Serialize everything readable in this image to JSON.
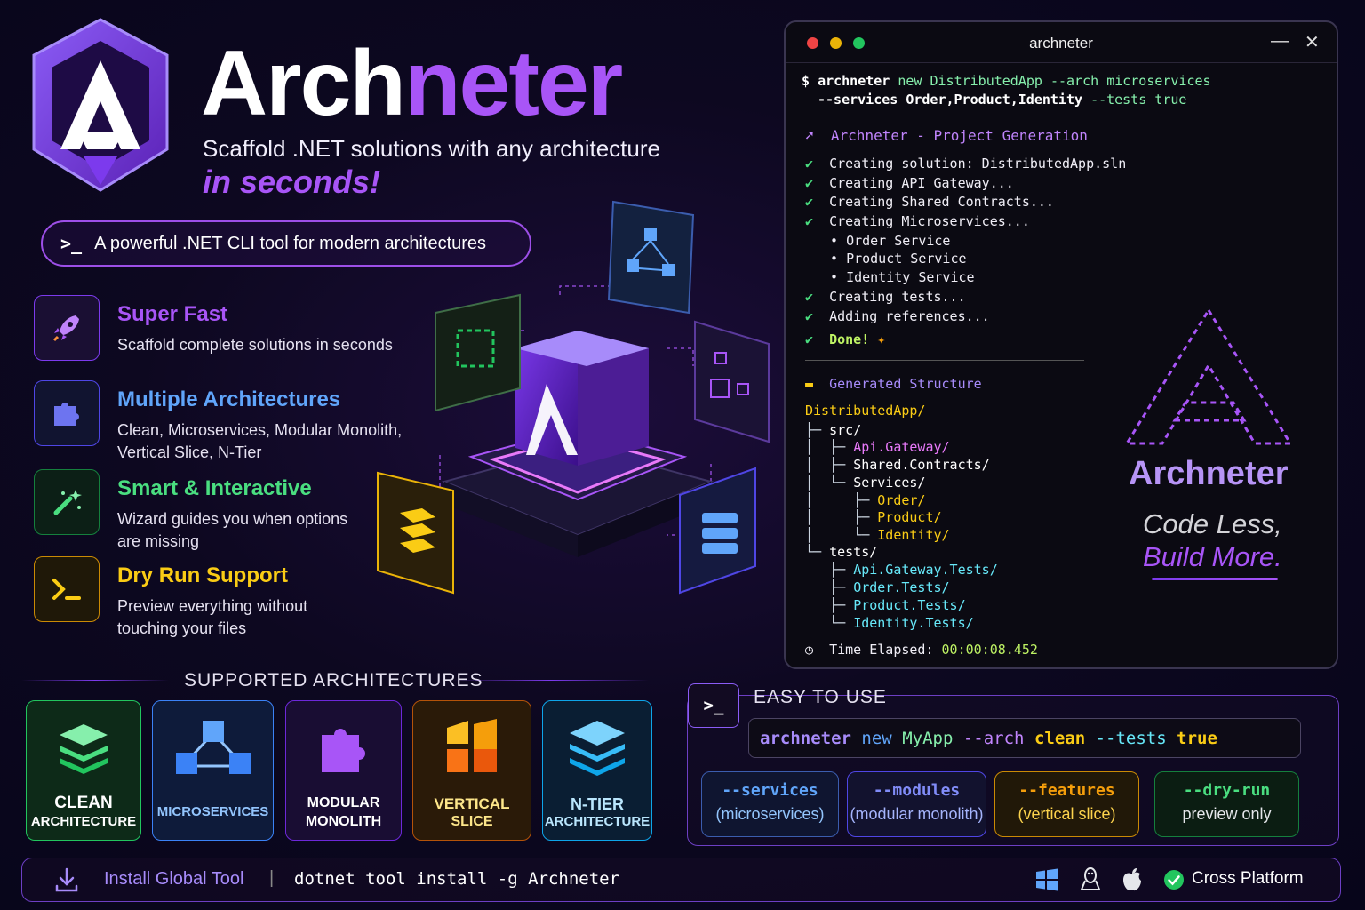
{
  "brand": {
    "name_part1": "Arch",
    "name_part2": "neter",
    "subtitle": "Scaffold .NET solutions with any architecture",
    "tagline": "in seconds!",
    "pill_prompt": ">_",
    "pill_text": "A powerful .NET CLI tool for modern architectures"
  },
  "features": [
    {
      "title": "Super Fast",
      "desc": "Scaffold complete solutions in seconds",
      "color": "#a855f7",
      "icon": "rocket-icon"
    },
    {
      "title": "Multiple Architectures",
      "desc": "Clean, Microservices, Modular Monolith, Vertical Slice, N-Tier",
      "color": "#60a5fa",
      "icon": "puzzle-icon"
    },
    {
      "title": "Smart & Interactive",
      "desc": "Wizard guides you when options are missing",
      "color": "#4ade80",
      "icon": "magic-wand-icon"
    },
    {
      "title": "Dry Run Support",
      "desc": "Preview everything without touching your files",
      "color": "#facc15",
      "icon": "terminal-icon"
    }
  ],
  "terminal": {
    "window_title": "archneter",
    "minimize": "—",
    "close": "✕",
    "cmd_prompt": "$",
    "cmd_main": "archneter",
    "cmd_new": "new",
    "cmd_app": "DistributedApp",
    "cmd_arch_flag": "--arch",
    "cmd_arch_val": "microservices",
    "cmd_services_flag": "--services",
    "cmd_services_val": "Order,Product,Identity",
    "cmd_tests_flag": "--tests",
    "cmd_tests_val": "true",
    "gen_title": "Archneter - Project Generation",
    "steps": [
      "Creating solution: DistributedApp.sln",
      "Creating API Gateway...",
      "Creating Shared Contracts...",
      "Creating Microservices..."
    ],
    "services": [
      "Order Service",
      "Product Service",
      "Identity Service"
    ],
    "steps2": [
      "Creating tests...",
      "Adding references..."
    ],
    "done": "Done!",
    "structure_title": "Generated Structure",
    "root": "DistributedApp/",
    "src": "src/",
    "api_gateway": "Api.Gateway/",
    "shared_contracts": "Shared.Contracts/",
    "services_dir": "Services/",
    "order_dir": "Order/",
    "product_dir": "Product/",
    "identity_dir": "Identity/",
    "tests_dir": "tests/",
    "t_api": "Api.Gateway.Tests/",
    "t_order": "Order.Tests/",
    "t_product": "Product.Tests/",
    "t_identity": "Identity.Tests/",
    "elapsed_label": "Time Elapsed:",
    "elapsed_value": "00:00:08.452",
    "side_brand": "Archneter",
    "side_line1": "Code Less,",
    "side_line2": "Build More."
  },
  "supported": {
    "title": "SUPPORTED ARCHITECTURES",
    "items": [
      {
        "line1": "CLEAN",
        "line2": "ARCHITECTURE",
        "color": "#4ade80"
      },
      {
        "line1": "MICROSERVICES",
        "line2": "",
        "color": "#60a5fa"
      },
      {
        "line1": "MODULAR",
        "line2": "MONOLITH",
        "color": "#a855f7"
      },
      {
        "line1": "VERTICAL",
        "line2": "SLICE",
        "color": "#f59e0b"
      },
      {
        "line1": "N-TIER",
        "line2": "ARCHITECTURE",
        "color": "#38bdf8"
      }
    ]
  },
  "easy": {
    "title": "EASY TO USE",
    "icon_text": ">_",
    "cmd_main": "archneter",
    "cmd_new": "new",
    "cmd_app": "MyApp",
    "cmd_arch_flag": "--arch",
    "cmd_arch_val": "clean",
    "cmd_tests_flag": "--tests",
    "cmd_tests_val": "true",
    "options": [
      {
        "flag": "--services",
        "desc": "(microservices)",
        "color": "#60a5fa"
      },
      {
        "flag": "--modules",
        "desc": "(modular monolith)",
        "color": "#818cf8"
      },
      {
        "flag": "--features",
        "desc": "(vertical slice)",
        "color": "#f59e0b"
      },
      {
        "flag": "--dry-run",
        "desc": "preview only",
        "color": "#4ade80"
      }
    ]
  },
  "install": {
    "label": "Install Global Tool",
    "separator": "|",
    "command": "dotnet tool install -g Archneter",
    "cross_platform": "Cross Platform"
  }
}
